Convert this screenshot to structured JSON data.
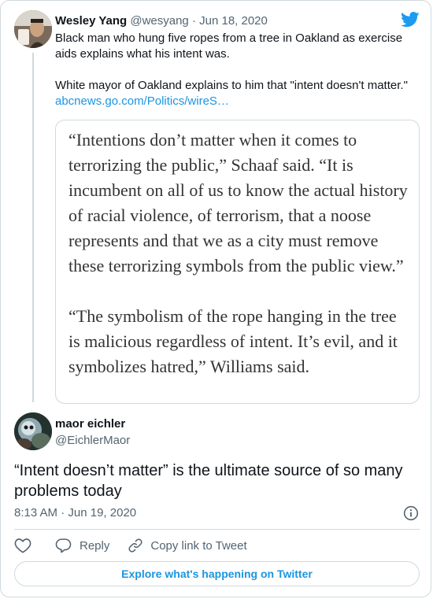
{
  "colors": {
    "accent": "#1b95e0",
    "text": "#0f1419",
    "muted": "#536471",
    "border": "#cfd9de"
  },
  "parent_tweet": {
    "avatar_icon": "user-photo-avatar",
    "name": "Wesley Yang",
    "handle": "@wesyang",
    "separator": "·",
    "date": "Jun 18, 2020",
    "text_line1": "Black man who hung five ropes from a tree in Oakland as exercise aids explains what his intent was.",
    "text_line2": "White mayor of Oakland explains to him that \"intent doesn't matter.\"",
    "link": "abcnews.go.com/Politics/wireS…",
    "quote_image": {
      "paragraph1": "“Intentions don’t matter when it comes to terrorizing the public,” Schaaf said. “It is incumbent on all of us to know the actual history of racial violence, of terrorism, that a noose represents and that we as a city must remove these terrorizing symbols from the public view.”",
      "paragraph2": "“The symbolism of the rope hanging in the tree is malicious regardless of intent. It’s evil, and it symbolizes hatred,” Williams said."
    }
  },
  "main_tweet": {
    "avatar_icon": "user-photo-avatar",
    "name": "maor eichler",
    "handle": "@EichlerMaor",
    "text": "“Intent doesn’t matter” is the ultimate source of so many problems today",
    "time": "8:13 AM",
    "separator": "·",
    "date": "Jun 19, 2020"
  },
  "actions": {
    "like_icon": "heart-icon",
    "reply_icon": "reply-bubble-icon",
    "reply_label": "Reply",
    "copy_icon": "link-icon",
    "copy_label": "Copy link to Tweet"
  },
  "explore_label": "Explore what's happening on Twitter",
  "twitter_logo_icon": "twitter-bird-icon",
  "info_icon": "info-icon"
}
